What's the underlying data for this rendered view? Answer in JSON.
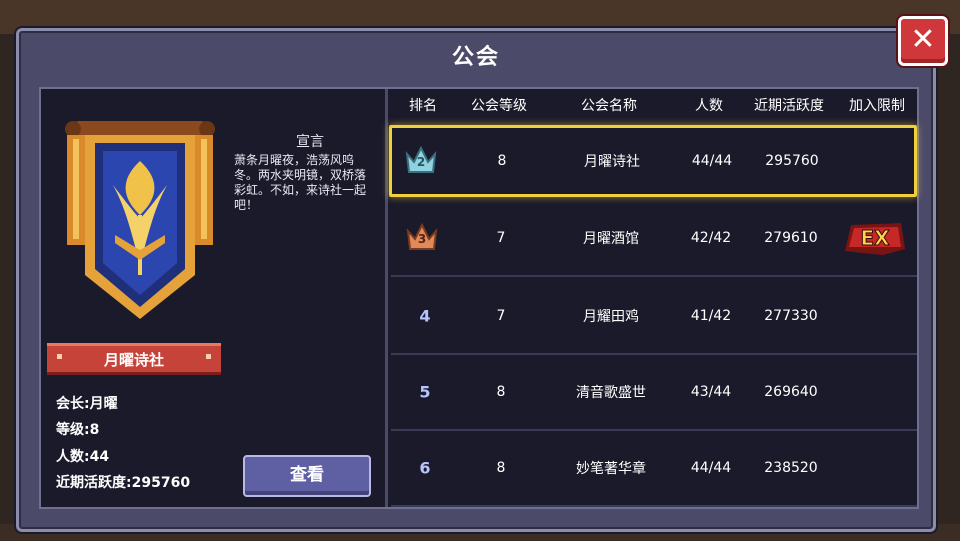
{
  "window": {
    "title": "公会",
    "close_label": "✕"
  },
  "guild": {
    "manifesto_title": "宣言",
    "manifesto_text": "萧条月曜夜，浩荡风呜冬。两水夹明镜，双桥落彩虹。不如，来诗社一起吧！",
    "name": "月曜诗社",
    "leader_label": "会长:",
    "leader": "月曜",
    "level_label": "等级:",
    "level": "8",
    "members_label": "人数:",
    "members": "44",
    "activity_label": "近期活跃度:",
    "activity": "295760",
    "view_button": "查看"
  },
  "table": {
    "headers": [
      "排名",
      "公会等级",
      "公会名称",
      "人数",
      "近期活跃度",
      "加入限制"
    ],
    "rows": [
      {
        "rank": "2",
        "rank_style": "silver-crown",
        "level": "8",
        "name": "月曜诗社",
        "members": "44/44",
        "activity": "295760",
        "restriction": "",
        "selected": true
      },
      {
        "rank": "3",
        "rank_style": "bronze-crown",
        "level": "7",
        "name": "月曜酒馆",
        "members": "42/42",
        "activity": "279610",
        "restriction": "EX",
        "selected": false
      },
      {
        "rank": "4",
        "rank_style": "number",
        "level": "7",
        "name": "月耀田鸡",
        "members": "41/42",
        "activity": "277330",
        "restriction": "",
        "selected": false
      },
      {
        "rank": "5",
        "rank_style": "number",
        "level": "8",
        "name": "清音歌盛世",
        "members": "43/44",
        "activity": "269640",
        "restriction": "",
        "selected": false
      },
      {
        "rank": "6",
        "rank_style": "number",
        "level": "8",
        "name": "妙笔著华章",
        "members": "44/44",
        "activity": "238520",
        "restriction": "",
        "selected": false
      }
    ]
  },
  "colors": {
    "panel": "#4b4a69",
    "inner": "#1b1a2a",
    "selected_border": "#f2d03c",
    "close": "#d0373a",
    "ribbon": "#c6433a",
    "button": "#5f5fa3"
  }
}
